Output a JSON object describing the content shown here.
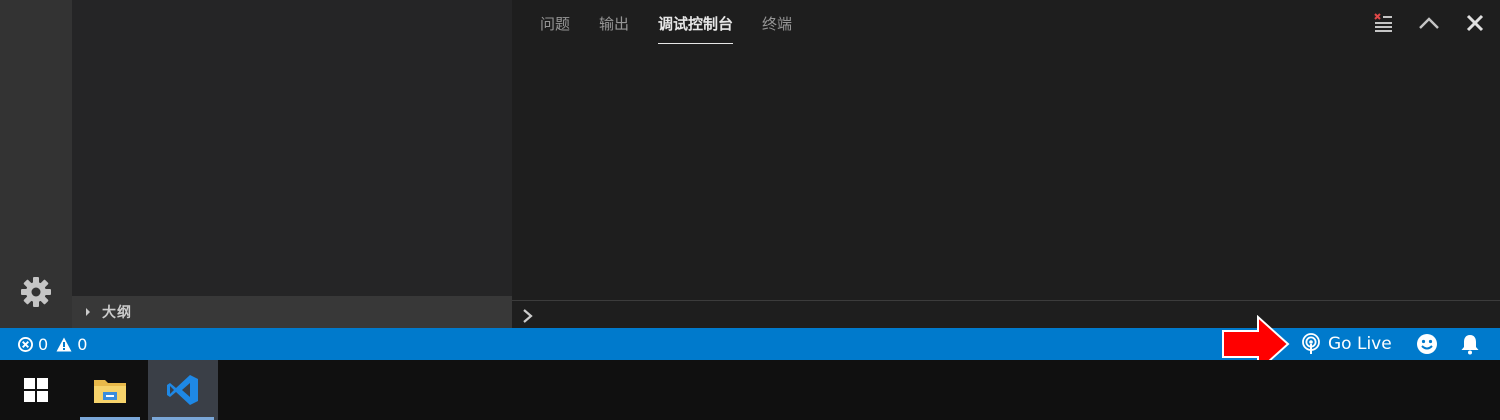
{
  "sidebar": {
    "outline_label": "大纲"
  },
  "panel": {
    "tabs": [
      {
        "label": "问题",
        "active": false
      },
      {
        "label": "输出",
        "active": false
      },
      {
        "label": "调试控制台",
        "active": true
      },
      {
        "label": "终端",
        "active": false
      }
    ],
    "actions": [
      "clear-console-icon",
      "chevron-up-icon",
      "close-icon"
    ]
  },
  "status_bar": {
    "errors": "0",
    "warnings": "0",
    "go_live_label": "Go Live",
    "background_color": "#007acc"
  },
  "annotation": {
    "arrow_color": "#ff0000"
  },
  "taskbar": {
    "items": [
      "windows-start-icon",
      "file-explorer-icon",
      "vscode-icon"
    ]
  },
  "colors": {
    "activity_bar": "#333333",
    "sidebar": "#252526",
    "panel": "#1e1e1e",
    "taskbar": "#101010"
  }
}
